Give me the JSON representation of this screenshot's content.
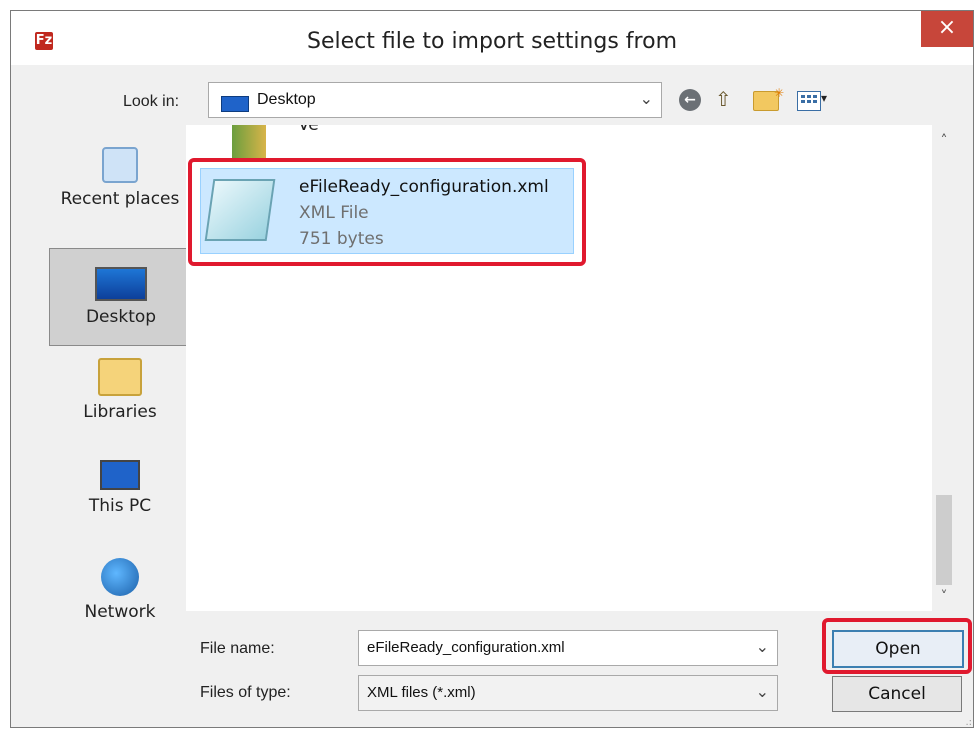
{
  "window": {
    "title": "Select file to import settings from",
    "app_icon_text": "Fz",
    "close_label": "×"
  },
  "lookin": {
    "label": "Look in:",
    "value": "Desktop",
    "chevron": "⌄"
  },
  "toolbar": {
    "back_icon": "back-arrow-icon",
    "up_icon": "up-folder-icon",
    "new_folder_icon": "new-folder-icon",
    "view_menu_icon": "view-menu-icon",
    "back_glyph": "←",
    "up_glyph": "⇧",
    "view_drop_glyph": "▾"
  },
  "places": {
    "items": [
      {
        "label": "Recent places",
        "icon": "recent-places-icon"
      },
      {
        "label": "Desktop",
        "icon": "desktop-icon",
        "selected": true
      },
      {
        "label": "Libraries",
        "icon": "libraries-icon"
      },
      {
        "label": "This PC",
        "icon": "this-pc-icon"
      },
      {
        "label": "Network",
        "icon": "network-icon"
      }
    ]
  },
  "filelist": {
    "partial_item_text": "Ver",
    "selected_file": {
      "name": "eFileReady_configuration.xml",
      "type": "XML File",
      "size": "751 bytes"
    }
  },
  "scrollbar": {
    "up_glyph": "˄",
    "down_glyph": "˅"
  },
  "footer": {
    "file_name_label": "File name:",
    "file_name_value": "eFileReady_configuration.xml",
    "file_type_label": "Files of type:",
    "file_type_value": "XML files (*.xml)",
    "chevron": "⌄",
    "open_label": "Open",
    "cancel_label": "Cancel",
    "resize_glyph": ".:"
  },
  "colors": {
    "highlight_red": "#e0192e",
    "selection_blue": "#cce8ff",
    "close_red": "#c7463a"
  }
}
